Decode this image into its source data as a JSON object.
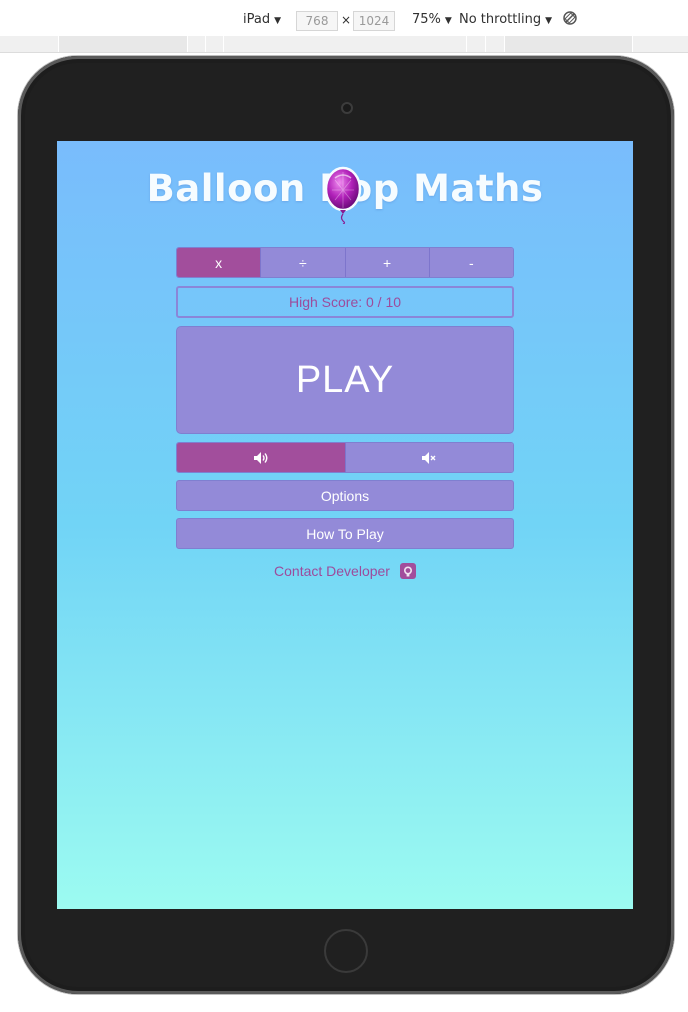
{
  "devtools": {
    "device": "iPad",
    "width": "768",
    "height": "1024",
    "x_sep": "×",
    "zoom": "75%",
    "throttling": "No throttling"
  },
  "app": {
    "title_left": "Balloon ",
    "title_mid": "Pop",
    "title_right": " Maths",
    "operations": [
      {
        "label": "x",
        "active": true
      },
      {
        "label": "÷",
        "active": false
      },
      {
        "label": "+",
        "active": false
      },
      {
        "label": "-",
        "active": false
      }
    ],
    "high_score": "High Score: 0 / 10",
    "play_label": "PLAY",
    "sound_on_icon": "speaker-on-icon",
    "sound_off_icon": "speaker-mute-icon",
    "options_label": "Options",
    "how_to_play_label": "How To Play",
    "contact_label": "Contact Developer",
    "contact_icon": "github-icon"
  },
  "colors": {
    "accent": "#a24e9c",
    "button": "#938ad8",
    "bg_top": "#79bcfc",
    "bg_bottom": "#9cfbf1"
  }
}
